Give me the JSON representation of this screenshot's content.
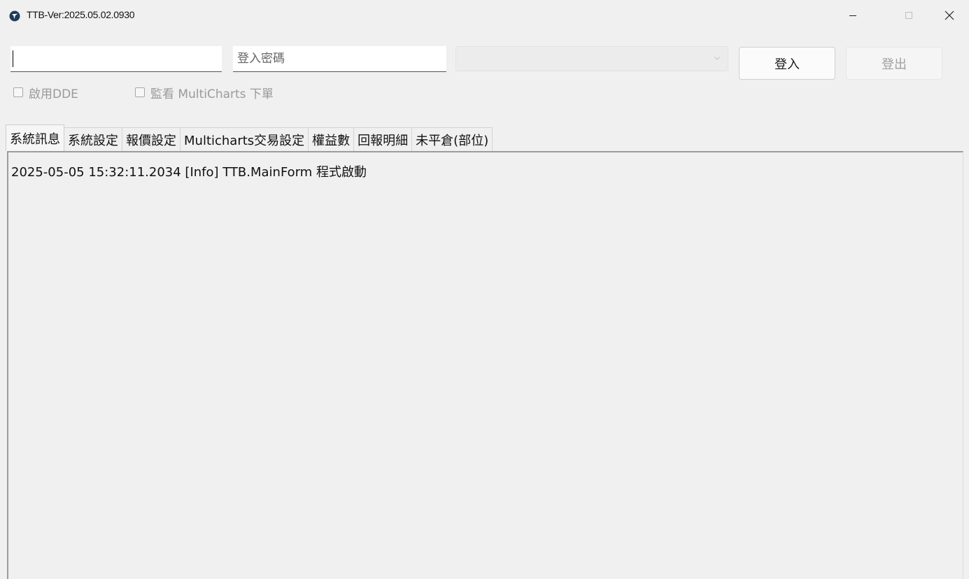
{
  "window": {
    "title": "TTB-Ver:2025.05.02.0930",
    "icon": "ttb-app-icon",
    "controls": {
      "minimize_icon": "minimize-icon",
      "maximize_icon": "maximize-icon",
      "close_icon": "close-icon"
    }
  },
  "login": {
    "account_value": "",
    "password_placeholder": "登入密碼",
    "server_selected": "",
    "login_label": "登入",
    "logout_label": "登出"
  },
  "options": {
    "enable_dde_label": "啟用DDE",
    "enable_dde_checked": false,
    "watch_mc_label": "監看 MultiCharts 下單",
    "watch_mc_checked": false
  },
  "tabs": [
    {
      "label": "系統訊息",
      "active": true
    },
    {
      "label": "系統設定",
      "active": false
    },
    {
      "label": "報價設定",
      "active": false
    },
    {
      "label": "Multicharts交易設定",
      "active": false
    },
    {
      "label": "權益數",
      "active": false
    },
    {
      "label": "回報明細",
      "active": false
    },
    {
      "label": "未平倉(部位)",
      "active": false
    }
  ],
  "log": {
    "lines": [
      "2025-05-05 15:32:11.2034 [Info] TTB.MainForm  程式啟動"
    ]
  },
  "colors": {
    "window_bg": "#f0f0f0",
    "disabled_text": "#9a9a9a",
    "app_icon": "#1f3b57"
  }
}
